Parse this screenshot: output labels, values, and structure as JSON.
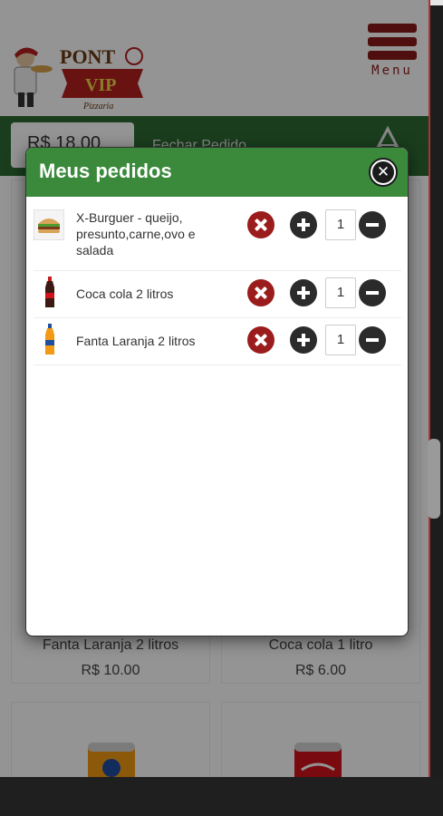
{
  "header": {
    "brand_top": "PONT",
    "brand_badge": "VIP",
    "brand_sub": "Pizzaria",
    "menu_label": "Menu"
  },
  "cart_bar": {
    "total": "R$ 18.00",
    "finish_label": "Fechar Pedido"
  },
  "products": [
    {
      "name": "Fanta Laranja 2 litros",
      "price": "R$ 10.00"
    },
    {
      "name": "Coca cola 1 litro",
      "price": "R$ 6.00"
    }
  ],
  "modal": {
    "title": "Meus pedidos",
    "close_icon": "close-circle-icon",
    "items": [
      {
        "name": "X-Burguer - queijo, presunto,carne,ovo e salada",
        "qty": "1",
        "icon": "burger"
      },
      {
        "name": "Coca cola 2 litros",
        "qty": "1",
        "icon": "coke-bottle"
      },
      {
        "name": "Fanta Laranja 2 litros",
        "qty": "1",
        "icon": "fanta-bottle"
      }
    ]
  },
  "colors": {
    "header_green": "#3b8a3c",
    "page_green": "#2e6b33",
    "remove_red": "#9b1c1c",
    "brand_red": "#8b1a1a"
  }
}
